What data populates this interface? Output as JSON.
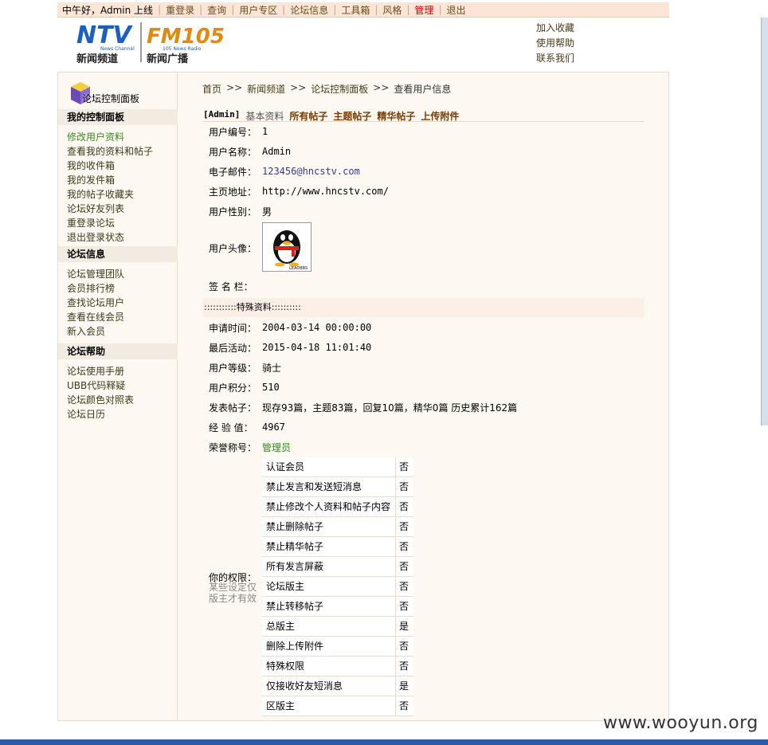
{
  "topbar": {
    "greeting": "中午好，Admin 上线",
    "items": [
      "重登录",
      "查询",
      "用户专区",
      "论坛信息",
      "工具箱",
      "风格",
      "管理",
      "退出"
    ]
  },
  "header": {
    "logo": {
      "ntv_text": "NTV",
      "ntv_sub_en": "News Channel",
      "ntv_sub_cn": "新闻频道",
      "fm_text": "FM105",
      "fm_sub_en": "105 News Radio",
      "fm_sub_cn": "新闻广播"
    },
    "links": [
      "加入收藏",
      "使用帮助",
      "联系我们"
    ]
  },
  "sidebar": {
    "logo_title": "论坛控制面板",
    "sections": [
      {
        "title": "我的控制面板",
        "items": [
          "修改用户资料",
          "查看我的资料和帖子",
          "我的收件箱",
          "我的发件箱",
          "我的帖子收藏夹",
          "论坛好友列表",
          "重登录论坛",
          "退出登录状态"
        ]
      },
      {
        "title": "论坛信息",
        "items": [
          "论坛管理团队",
          "会员排行榜",
          "查找论坛用户",
          "查看在线会员",
          "新入会员"
        ]
      },
      {
        "title": "论坛帮助",
        "items": [
          "论坛使用手册",
          "UBB代码释疑",
          "论坛颜色对照表",
          "论坛日历"
        ]
      }
    ]
  },
  "breadcrumb": {
    "items": [
      "首页",
      "新闻频道",
      "论坛控制面板",
      "查看用户信息"
    ],
    "sep": ">>"
  },
  "tabs": {
    "user": "[Admin]",
    "items": [
      "基本资料",
      "所有帖子",
      "主题帖子",
      "精华帖子",
      "上传附件"
    ]
  },
  "profile": {
    "id_label": "用户编号：",
    "id": "1",
    "name_label": "用户名称：",
    "name": "Admin",
    "email_label": "电子邮件：",
    "email": "123456@hncstv.com",
    "home_label": "主页地址：",
    "home": "http://www.hncstv.com/",
    "gender_label": "用户性别：",
    "gender": "男",
    "avatar_label": "用户头像：",
    "avatar_caption": "LEADBBS",
    "sign_label": "签 名 栏："
  },
  "special": {
    "title": ":::::::::::特殊资料::::::::::"
  },
  "details": {
    "reg_label": "申请时间：",
    "reg": "2004-03-14 00:00:00",
    "last_label": "最后活动：",
    "last": "2015-04-18 11:01:40",
    "level_label": "用户等级：",
    "level": "骑士",
    "points_label": "用户积分：",
    "points": "510",
    "posts_label": "发表帖子：",
    "posts": "现存93篇，主题83篇，回复10篇，精华0篇 历史累计162篇",
    "exp_label": "经 验 值：",
    "exp": "4967",
    "honor_label": "荣誉称号：",
    "honor": "管理员"
  },
  "permissions": {
    "label": "你的权限：",
    "note": "某些设定仅版主才有效",
    "rows": [
      {
        "name": "认证会员",
        "value": "否"
      },
      {
        "name": "禁止发言和发送短消息",
        "value": "否"
      },
      {
        "name": "禁止修改个人资料和帖子内容",
        "value": "否"
      },
      {
        "name": "禁止删除帖子",
        "value": "否"
      },
      {
        "name": "禁止精华帖子",
        "value": "否"
      },
      {
        "name": "所有发言屏蔽",
        "value": "否"
      },
      {
        "name": "论坛版主",
        "value": "否"
      },
      {
        "name": "禁止转移帖子",
        "value": "否"
      },
      {
        "name": "总版主",
        "value": "是"
      },
      {
        "name": "删除上传附件",
        "value": "否"
      },
      {
        "name": "特殊权限",
        "value": "否"
      },
      {
        "name": "仅接收好友短消息",
        "value": "是"
      },
      {
        "name": "区版主",
        "value": "否"
      }
    ]
  },
  "watermark": "www.wooyun.org"
}
